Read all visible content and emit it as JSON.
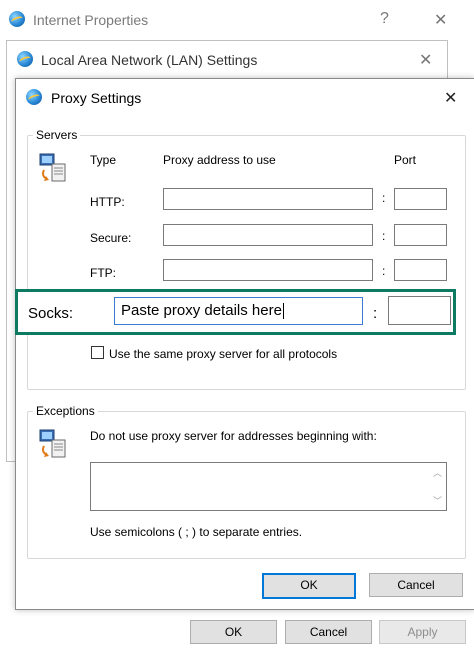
{
  "internet_properties": {
    "title": "Internet Properties",
    "help_glyph": "?",
    "close_glyph": "✕",
    "buttons": {
      "ok": "OK",
      "cancel": "Cancel",
      "apply": "Apply"
    }
  },
  "lan_settings": {
    "title": "Local Area Network (LAN) Settings",
    "close_glyph": "✕"
  },
  "proxy_settings": {
    "title": "Proxy Settings",
    "close_glyph": "✕",
    "servers": {
      "group_label": "Servers",
      "col_type": "Type",
      "col_address": "Proxy address to use",
      "col_port": "Port",
      "rows": [
        {
          "label": "HTTP:",
          "address": "",
          "port": ""
        },
        {
          "label": "Secure:",
          "address": "",
          "port": ""
        },
        {
          "label": "FTP:",
          "address": "",
          "port": ""
        }
      ],
      "socks": {
        "label": "Socks:",
        "address": "Paste proxy details here",
        "port": ""
      },
      "colon": ":",
      "same_proxy_label": "Use the same proxy server for all protocols",
      "same_proxy_checked": false
    },
    "exceptions": {
      "group_label": "Exceptions",
      "description": "Do not use proxy server for addresses beginning with:",
      "value": "",
      "hint": "Use semicolons ( ; ) to separate entries."
    },
    "buttons": {
      "ok": "OK",
      "cancel": "Cancel"
    }
  },
  "colors": {
    "highlight_border": "#0e7a62",
    "focus_blue": "#0078d7"
  }
}
